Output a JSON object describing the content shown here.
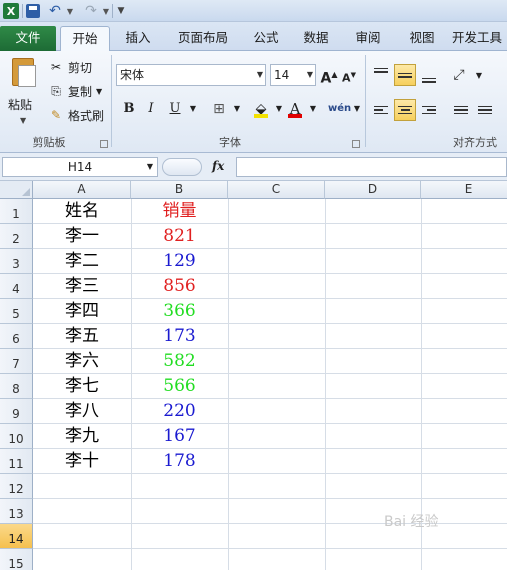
{
  "quick_access": {
    "app_icon": "excel-logo-icon",
    "logo_letter": "X"
  },
  "tabs": [
    "文件",
    "开始",
    "插入",
    "页面布局",
    "公式",
    "数据",
    "审阅",
    "视图",
    "开发工具"
  ],
  "ribbon": {
    "clipboard": {
      "paste": "粘贴",
      "cut": "剪切",
      "copy": "复制",
      "format_painter": "格式刷",
      "label": "剪贴板"
    },
    "font": {
      "family": "宋体",
      "size": "14",
      "bold": "B",
      "italic": "I",
      "underline": "U",
      "label": "字体"
    },
    "alignment": {
      "label": "对齐方式"
    }
  },
  "formula_bar": {
    "name_box": "H14",
    "fx": "fx",
    "content": ""
  },
  "sheet": {
    "columns": [
      "A",
      "B",
      "C",
      "D",
      "E"
    ],
    "rows": [
      "1",
      "2",
      "3",
      "4",
      "5",
      "6",
      "7",
      "8",
      "9",
      "10",
      "11",
      "12",
      "13",
      "14",
      "15"
    ],
    "active_row": "14",
    "header": {
      "name": "姓名",
      "sales": "销量",
      "sales_color": "#e02020"
    },
    "data": [
      {
        "name": "李一",
        "sales": "821",
        "color": "#e02020"
      },
      {
        "name": "李二",
        "sales": "129",
        "color": "#1a1ad0"
      },
      {
        "name": "李三",
        "sales": "856",
        "color": "#e02020"
      },
      {
        "name": "李四",
        "sales": "366",
        "color": "#22dd22"
      },
      {
        "name": "李五",
        "sales": "173",
        "color": "#1a1ad0"
      },
      {
        "name": "李六",
        "sales": "582",
        "color": "#22dd22"
      },
      {
        "name": "李七",
        "sales": "566",
        "color": "#22dd22"
      },
      {
        "name": "李八",
        "sales": "220",
        "color": "#1a1ad0"
      },
      {
        "name": "李九",
        "sales": "167",
        "color": "#1a1ad0"
      },
      {
        "name": "李十",
        "sales": "178",
        "color": "#1a1ad0"
      }
    ]
  },
  "watermark": "Bai 经验"
}
